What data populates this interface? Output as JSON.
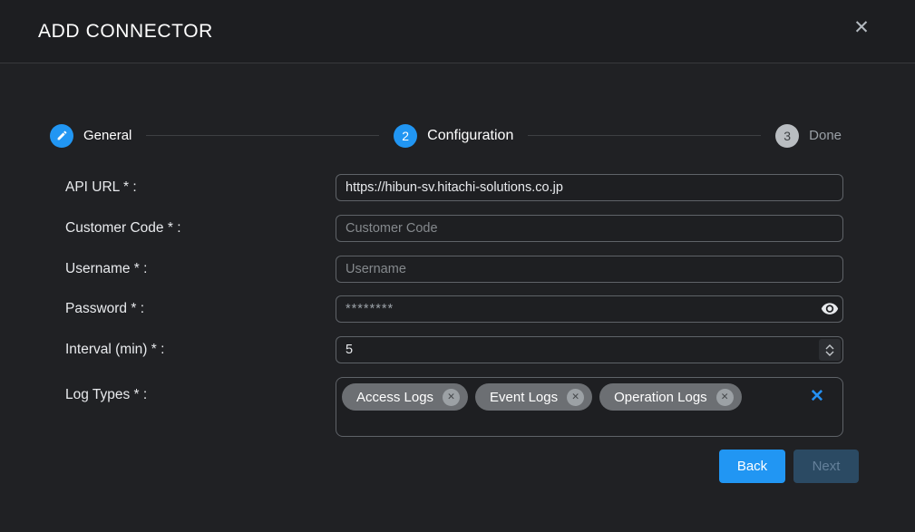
{
  "dialog": {
    "title": "ADD CONNECTOR"
  },
  "icons": {
    "close": "✕",
    "chip_remove": "✕",
    "clear": "✕"
  },
  "stepper": {
    "steps": [
      {
        "label": "General",
        "icon": "edit-pencil",
        "state": "completed"
      },
      {
        "number": "2",
        "label": "Configuration",
        "state": "active"
      },
      {
        "number": "3",
        "label": "Done",
        "state": "pending"
      }
    ]
  },
  "form": {
    "api_url": {
      "label": "API URL * :",
      "value": "https://hibun-sv.hitachi-solutions.co.jp"
    },
    "customer_code": {
      "label": "Customer Code * :",
      "placeholder": "Customer Code"
    },
    "username": {
      "label": "Username * :",
      "placeholder": "Username"
    },
    "password": {
      "label": "Password * :",
      "value": "********"
    },
    "interval": {
      "label": "Interval (min) * :",
      "value": "5"
    },
    "log_types": {
      "label": "Log Types * :",
      "chips": {
        "0": "Access Logs",
        "1": "Event Logs",
        "2": "Operation Logs"
      }
    }
  },
  "buttons": {
    "back": "Back",
    "next": "Next"
  },
  "colors": {
    "accent": "#2196f3",
    "header_bg": "#1d1e21",
    "body_bg": "#202124",
    "chip_bg": "#6c6f73",
    "next_disabled_bg": "#2b4a63"
  }
}
